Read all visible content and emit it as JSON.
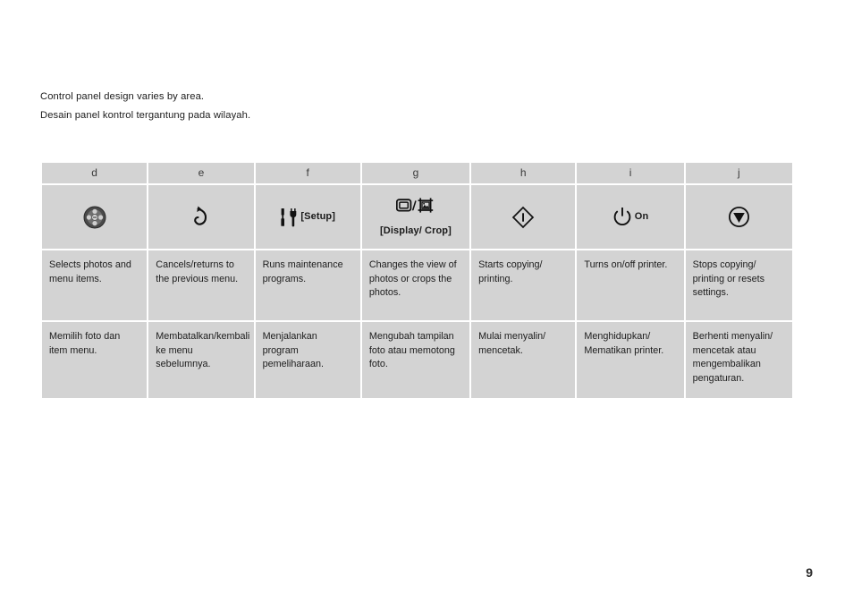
{
  "notes": {
    "line_en": "Control panel design varies by area.",
    "line_id": "Desain panel kontrol tergantung pada wilayah."
  },
  "table": {
    "column_letters": [
      "d",
      "e",
      "f",
      "g",
      "h",
      "i",
      "j"
    ],
    "icon_labels": {
      "d": "",
      "e": "",
      "f": "[Setup]",
      "g": "[Display/ Crop]",
      "h": "",
      "i": "On",
      "j": ""
    },
    "icon_names": {
      "d": "directional-pad-icon",
      "e": "back-arrow-icon",
      "f": "setup-tools-icon",
      "g": "display-crop-icon",
      "h": "start-diamond-icon",
      "i": "power-icon",
      "j": "stop-icon"
    },
    "descriptions_en": [
      "Selects photos and menu items.",
      "Cancels/returns to the previous menu.",
      "Runs maintenance programs.",
      "Changes the view of photos or crops the photos.",
      "Starts copying/ printing.",
      "Turns on/off printer.",
      "Stops copying/ printing or resets settings."
    ],
    "descriptions_id": [
      "Memilih foto dan item menu.",
      "Membatalkan/kembali ke menu sebelumnya.",
      "Menjalankan program pemeliharaan.",
      "Mengubah tampilan foto atau memotong foto.",
      "Mulai menyalin/ mencetak.",
      "Menghidupkan/ Mematikan printer.",
      "Berhenti menyalin/ mencetak atau mengembalikan pengaturan."
    ]
  },
  "footer": {
    "page_number": "9"
  },
  "colors": {
    "cell_background": "#d3d3d3",
    "page_background": "#ffffff",
    "text": "#1c1c1c",
    "header_letter": "#3a3a3a"
  }
}
